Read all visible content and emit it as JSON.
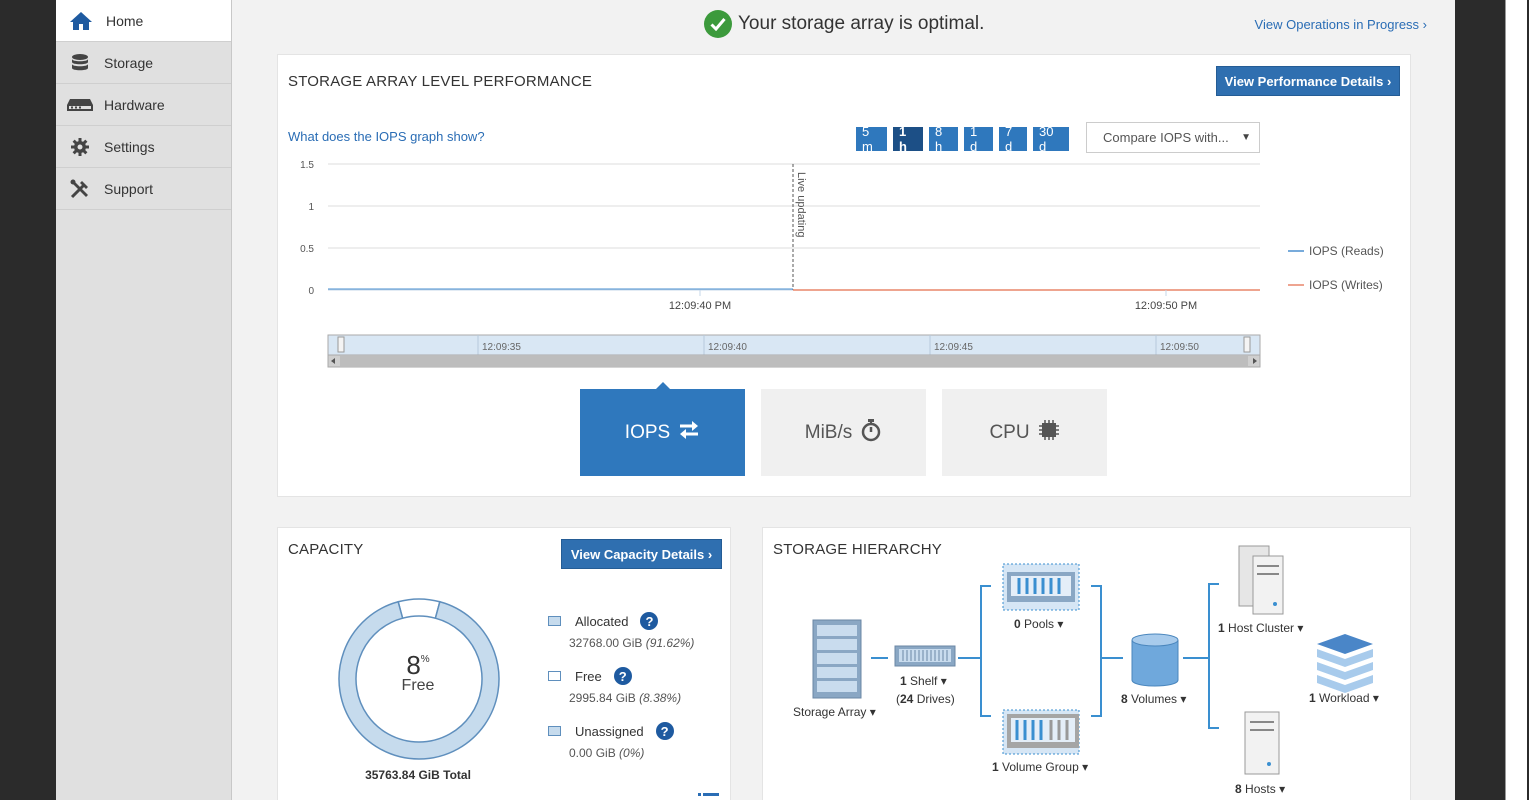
{
  "sidebar": {
    "items": [
      {
        "label": "Home",
        "icon": "home-icon",
        "active": true
      },
      {
        "label": "Storage",
        "icon": "database-icon"
      },
      {
        "label": "Hardware",
        "icon": "hardware-icon"
      },
      {
        "label": "Settings",
        "icon": "gear-icon"
      },
      {
        "label": "Support",
        "icon": "tools-icon"
      }
    ]
  },
  "header": {
    "status": "Your storage array is optimal.",
    "operations_link": "View Operations in Progress ›"
  },
  "performance": {
    "title": "STORAGE ARRAY LEVEL PERFORMANCE",
    "details_button": "View Performance Details ›",
    "help_link": "What does the IOPS graph show?",
    "ranges": [
      "5 m",
      "1 h",
      "8 h",
      "1 d",
      "7 d",
      "30 d"
    ],
    "active_range": "1 h",
    "compare_select": "Compare IOPS with...",
    "live_label": "Live updating",
    "tiles": [
      {
        "label": "IOPS",
        "icon": "swap-arrows-icon",
        "active": true
      },
      {
        "label": "MiB/s",
        "icon": "stopwatch-icon"
      },
      {
        "label": "CPU",
        "icon": "cpu-chip-icon"
      }
    ]
  },
  "chart_data": {
    "type": "line",
    "yticks": [
      "1.5",
      "1",
      "0.5",
      "0"
    ],
    "ylim": [
      0,
      1.5
    ],
    "xtick_labels": [
      "12:09:40 PM",
      "12:09:50 PM"
    ],
    "navigator_labels": [
      "12:09:35",
      "12:09:40",
      "12:09:45",
      "12:09:50"
    ],
    "series": [
      {
        "name": "IOPS (Reads)",
        "color": "#4a8fcf",
        "values": [
          0,
          0
        ]
      },
      {
        "name": "IOPS (Writes)",
        "color": "#e8866a",
        "values": [
          0,
          0
        ]
      }
    ],
    "grid": true,
    "legend_position": "right"
  },
  "capacity": {
    "title": "CAPACITY",
    "details_button": "View Capacity Details ›",
    "percent": "8",
    "percent_sign": "%",
    "free_label": "Free",
    "total": "35763.84 GiB Total",
    "free_fraction": 0.0838,
    "legend": [
      {
        "label": "Allocated",
        "value": "32768.00 GiB",
        "pct": "(91.62%)",
        "color": "#c6dbed"
      },
      {
        "label": "Free",
        "value": "2995.84 GiB",
        "pct": "(8.38%)",
        "color": "#ffffff"
      },
      {
        "label": "Unassigned",
        "value": "0.00 GiB",
        "pct": "(0%)",
        "color": "#c6dbed"
      }
    ],
    "help": "?"
  },
  "hierarchy": {
    "title": "STORAGE HIERARCHY",
    "storage_array": "Storage Array",
    "shelf_count": "1",
    "shelf_label": "Shelf",
    "drives": "(24 Drives)",
    "pools_count": "0",
    "pools_label": "Pools",
    "volume_group_count": "1",
    "volume_group_label": "Volume Group",
    "volumes_count": "8",
    "volumes_label": "Volumes",
    "host_cluster_count": "1",
    "host_cluster_label": "Host Cluster",
    "workload_count": "1",
    "workload_label": "Workload",
    "hosts_count": "8",
    "hosts_label": "Hosts",
    "caret": "▾"
  }
}
